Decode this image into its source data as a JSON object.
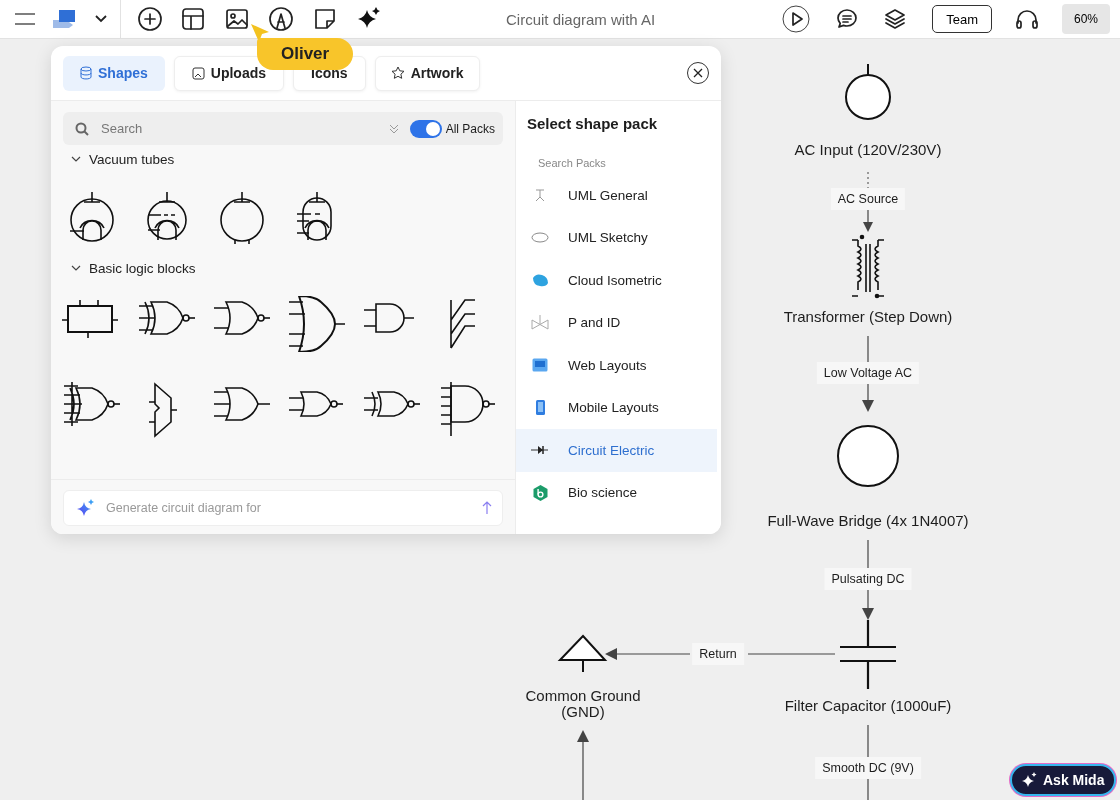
{
  "toolbar": {
    "title": "Circuit diagram with AI",
    "team": "Team",
    "zoom": "60%"
  },
  "cursor": {
    "name": "Oliver"
  },
  "panel": {
    "tabs": [
      {
        "label": "Shapes",
        "selected": true
      },
      {
        "label": "Uploads",
        "selected": false
      },
      {
        "label": "Icons",
        "selected": false
      },
      {
        "label": "Artwork",
        "selected": false
      }
    ],
    "search": {
      "placeholder": "Search"
    },
    "toggle": {
      "label": "All Packs",
      "on": true
    },
    "sections": [
      {
        "title": "Vacuum tubes",
        "expanded": true
      },
      {
        "title": "Basic logic blocks",
        "expanded": true
      }
    ],
    "prompt": {
      "placeholder": "Generate circuit diagram for"
    },
    "packs": {
      "title": "Select shape pack",
      "search_placeholder": "Search Packs",
      "items": [
        {
          "label": "UML General",
          "selected": false
        },
        {
          "label": "UML Sketchy",
          "selected": false
        },
        {
          "label": "Cloud Isometric",
          "selected": false
        },
        {
          "label": "P and ID",
          "selected": false
        },
        {
          "label": "Web Layouts",
          "selected": false
        },
        {
          "label": "Mobile Layouts",
          "selected": false
        },
        {
          "label": "Circuit Electric",
          "selected": true
        },
        {
          "label": "Bio science",
          "selected": false
        }
      ]
    }
  },
  "diagram": {
    "nodes": [
      {
        "kind": "source",
        "label": "AC Input (120V/230V)"
      },
      {
        "kind": "transformer",
        "label": "Transformer (Step Down)"
      },
      {
        "kind": "bridge",
        "label": "Full-Wave Bridge (4x 1N4007)"
      },
      {
        "kind": "ground",
        "label": "Common Ground (GND)"
      },
      {
        "kind": "capacitor",
        "label": "Filter Capacitor (1000uF)"
      }
    ],
    "edges": [
      {
        "label": "AC Source"
      },
      {
        "label": "Low Voltage AC"
      },
      {
        "label": "Pulsating DC"
      },
      {
        "label": "Return"
      },
      {
        "label": "Smooth DC (9V)"
      }
    ]
  },
  "assistant": {
    "label": "Ask Mida"
  }
}
